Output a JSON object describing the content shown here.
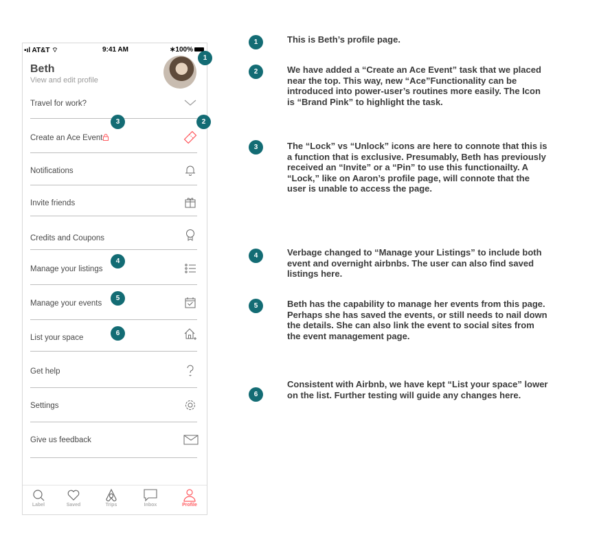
{
  "status": {
    "carrier": "AT&T",
    "time": "9:41 AM",
    "battery": "100%"
  },
  "profile": {
    "name": "Beth",
    "subtitle": "View and edit profile"
  },
  "menu": [
    {
      "label": "Travel for work?",
      "icon": "chevron-down-icon"
    },
    {
      "label": "Create an Ace Event",
      "icon": "ticket-icon",
      "accent": "#ff5a5f"
    },
    {
      "label": "Notifications",
      "icon": "bell-icon"
    },
    {
      "label": "Invite friends",
      "icon": "gift-icon"
    },
    {
      "label": "Credits and Coupons",
      "icon": "award-icon"
    },
    {
      "label": "Manage your listings",
      "icon": "list-icon"
    },
    {
      "label": "Manage your events",
      "icon": "calendar-check-icon"
    },
    {
      "label": "List your space",
      "icon": "home-plus-icon"
    },
    {
      "label": "Get help",
      "icon": "question-icon"
    },
    {
      "label": "Settings",
      "icon": "gear-icon"
    },
    {
      "label": "Give us feedback",
      "icon": "envelope-icon"
    }
  ],
  "tabs": [
    {
      "label": "Label",
      "icon": "search-icon"
    },
    {
      "label": "Saved",
      "icon": "heart-icon"
    },
    {
      "label": "Trips",
      "icon": "airbnb-logo-icon"
    },
    {
      "label": "Inbox",
      "icon": "chat-icon"
    },
    {
      "label": "Profile",
      "icon": "person-icon",
      "active": true
    }
  ],
  "badges": [
    "1",
    "2",
    "3",
    "4",
    "5",
    "6"
  ],
  "notes": [
    "This is Beth’s profile page.",
    "We have added a “Create an Ace Event” task that we placed near the top. This way, new “Ace”Functionality can be introduced into power-user’s routines more easily. The Icon is “Brand Pink” to highlight the task.",
    "The “Lock” vs “Unlock” icons are here to connote that this is a function that is exclusive. Presumably, Beth has previously received an “Invite” or a “Pin” to use this functionailty. A “Lock,” like on Aaron’s profile page, will connote that the user is unable to access the page.",
    "Verbage changed to “Manage your Listings” to include both event and overnight airbnbs. The user can also find saved listings here.",
    "Beth has the capability to manage her events from this page. Perhaps she has saved the events, or still needs to nail down the details. She can also link the event to social sites from the event management page.",
    "Consistent with Airbnb, we have kept “List your space” lower on the list. Further testing will guide any changes here."
  ],
  "colors": {
    "badge": "#136c74",
    "brand_pink": "#ff5a5f",
    "text": "#484848"
  }
}
